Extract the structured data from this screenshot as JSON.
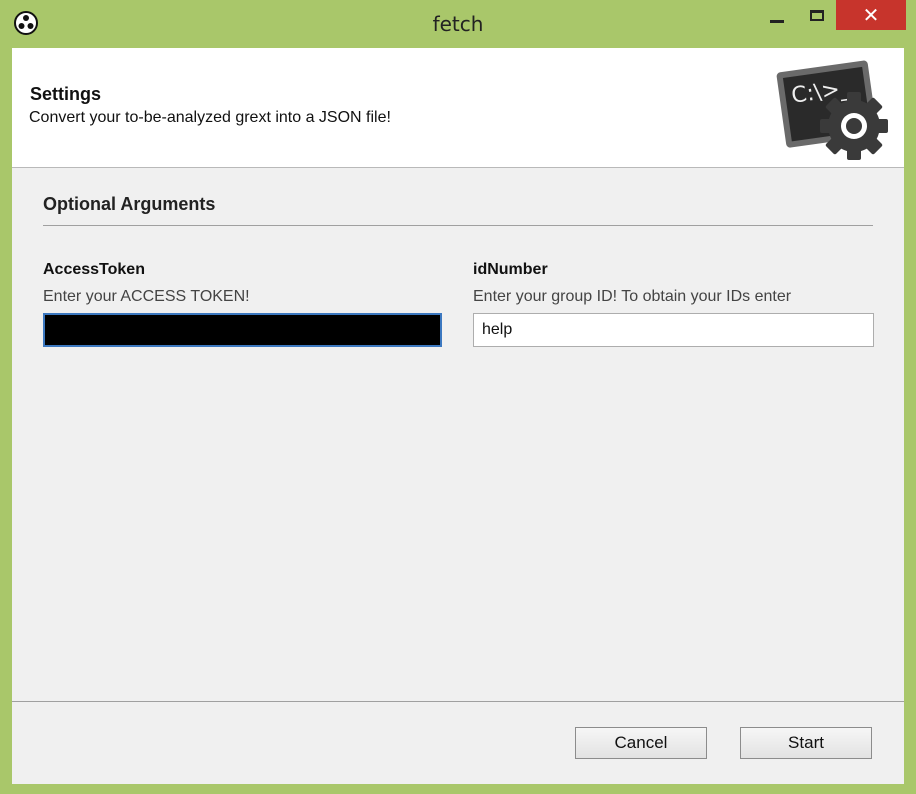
{
  "window": {
    "title": "fetch",
    "close_glyph": "✕",
    "frame_color": "#a9c76a",
    "close_color": "#c7342c"
  },
  "header": {
    "title": "Settings",
    "subtitle": "Convert your to-be-analyzed grext into a JSON file!",
    "logo_text": "C:\\>_",
    "logo_icon": "console-gear-icon"
  },
  "section": {
    "title": "Optional Arguments"
  },
  "fields": {
    "access_token": {
      "label": "AccessToken",
      "description": "Enter your ACCESS TOKEN!",
      "value": ""
    },
    "id_number": {
      "label": "idNumber",
      "description": "Enter your group ID! To obtain your IDs enter",
      "value": "help"
    }
  },
  "buttons": {
    "cancel": "Cancel",
    "start": "Start"
  }
}
